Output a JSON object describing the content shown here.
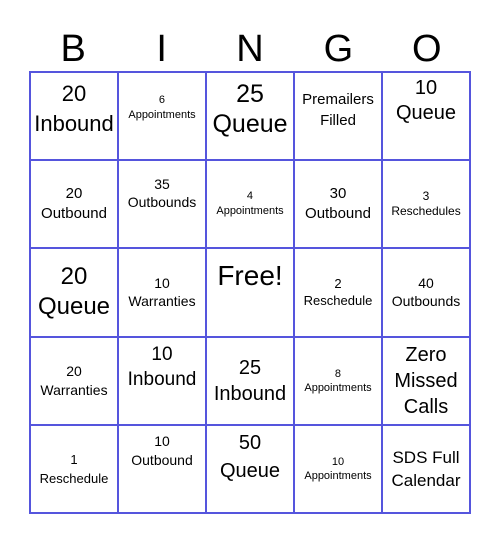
{
  "title_letters": [
    "B",
    "I",
    "N",
    "G",
    "O"
  ],
  "colors": {
    "grid_border": "#5555dd",
    "text": "#000000",
    "background": "#ffffff"
  },
  "cells": [
    [
      "20\nInbound",
      "6\nAppointments",
      "25\nQueue",
      "Premailers\nFilled",
      "10\nQueue"
    ],
    [
      "20\nOutbound",
      "35\nOutbounds",
      "4\nAppointments",
      "30\nOutbound",
      "3\nReschedules"
    ],
    [
      "20\nQueue",
      "10\nWarranties",
      "Free!",
      "2\nReschedule",
      "40\nOutbounds"
    ],
    [
      "20\nWarranties",
      "10\nInbound",
      "25\nInbound",
      "8\nAppointments",
      "Zero\nMissed\nCalls"
    ],
    [
      "1\nReschedule",
      "10\nOutbound",
      "50\nQueue",
      "10\nAppointments",
      "SDS Full\nCalendar"
    ]
  ]
}
